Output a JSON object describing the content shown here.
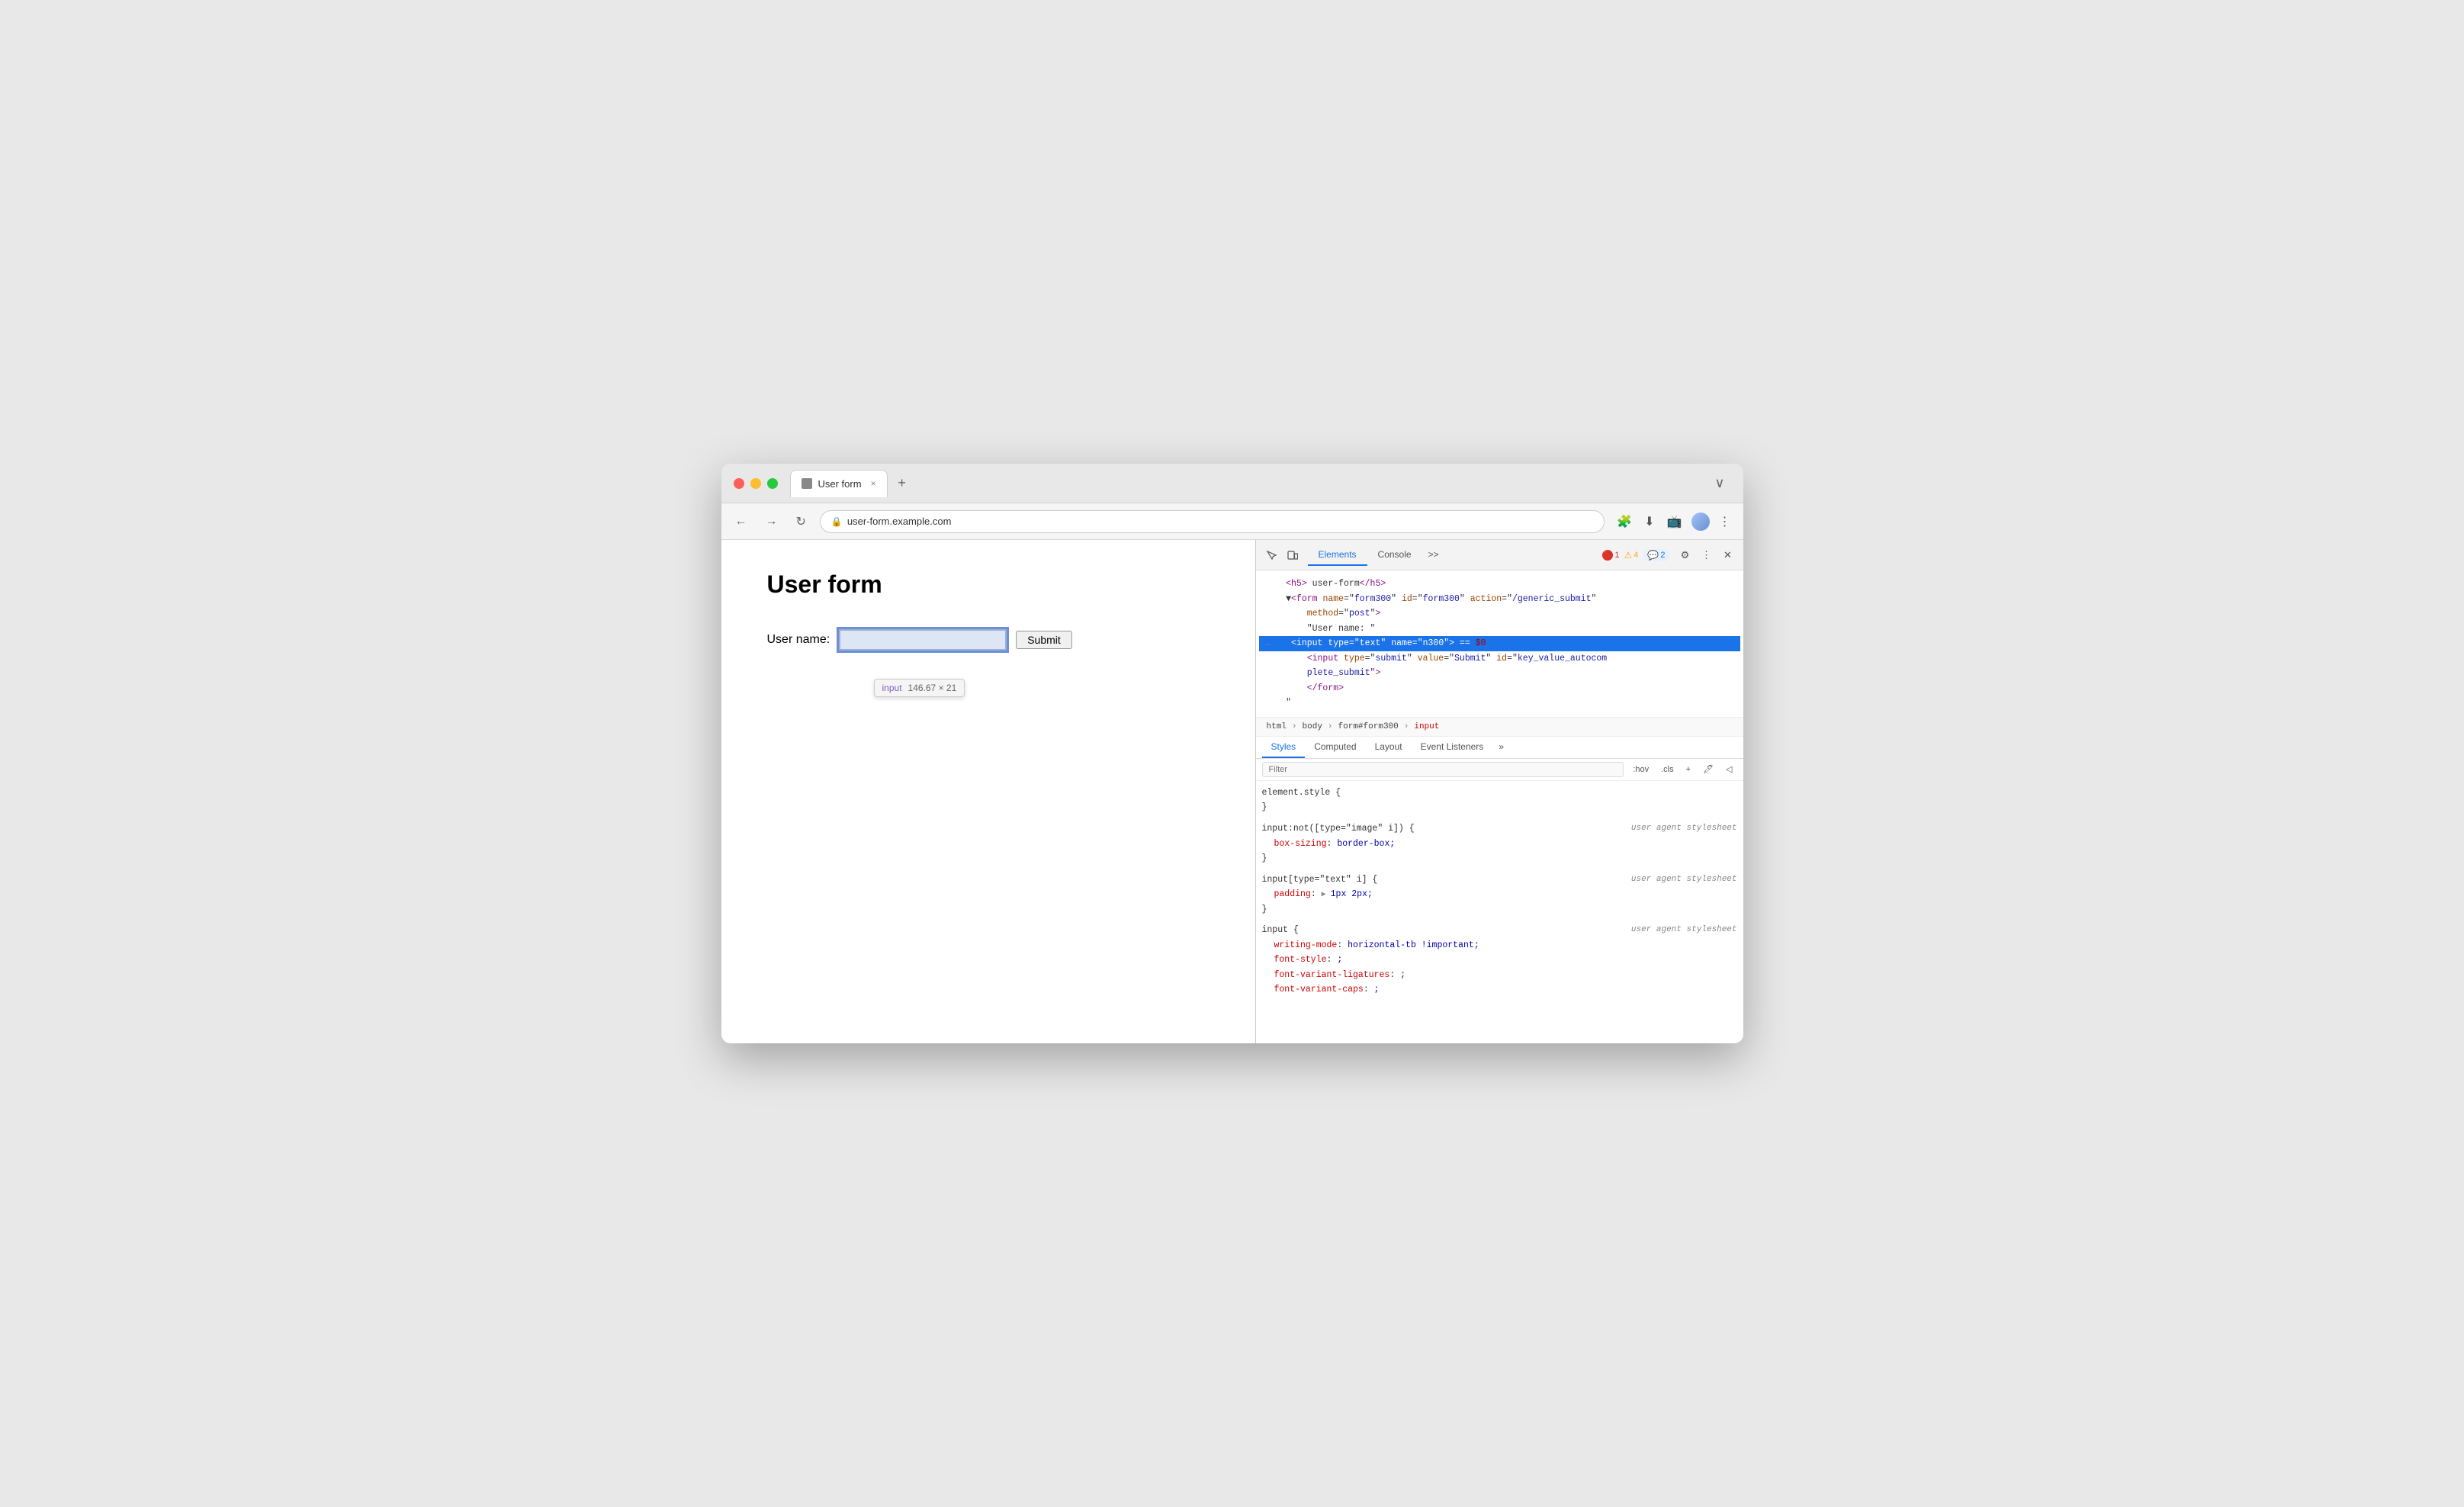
{
  "browser": {
    "tab": {
      "favicon": "page-icon",
      "title": "User form",
      "close": "×",
      "new_tab": "+"
    },
    "tab_more": "∨",
    "nav": {
      "back": "←",
      "forward": "→",
      "reload": "↻",
      "url": "user-form.example.com",
      "lock_icon": "🔒"
    },
    "toolbar": {
      "extensions": "🧩",
      "download": "⬇",
      "profile": "👤",
      "menu": "⋮",
      "cast": "📺"
    }
  },
  "page": {
    "title": "User form",
    "label": "User name:",
    "input_placeholder": "",
    "submit_label": "Submit",
    "tooltip": {
      "tag": "input",
      "size": "146.67 × 21"
    }
  },
  "devtools": {
    "header_icons": [
      "cursor-icon",
      "device-icon"
    ],
    "tabs": [
      "Elements",
      "Console"
    ],
    "tab_more": ">>",
    "status": {
      "errors": "1",
      "warnings": "4",
      "info": "2"
    },
    "settings_icon": "⚙",
    "more_icon": "⋮",
    "close_icon": "×",
    "elements_tree": [
      {
        "indent": 4,
        "content": "<h5>user-form</h5>",
        "html": "&lt;h5&gt; user-form &lt;/h5&gt;",
        "selected": false
      },
      {
        "indent": 4,
        "content": "form",
        "selected": false
      },
      {
        "indent": 6,
        "content": "\"User name: \"",
        "selected": false
      },
      {
        "indent": 6,
        "content": "input selected",
        "selected": true
      },
      {
        "indent": 6,
        "content": "input submit",
        "selected": false
      },
      {
        "indent": 4,
        "content": "/form",
        "selected": false
      },
      {
        "indent": 4,
        "content": "close",
        "selected": false
      }
    ],
    "breadcrumb": [
      "html",
      "body",
      "form#form300",
      "input"
    ],
    "styles_tabs": [
      "Styles",
      "Computed",
      "Layout",
      "Event Listeners"
    ],
    "styles_tab_more": "»",
    "filter_placeholder": "Filter",
    "filter_actions": [
      ":hov",
      ".cls",
      "+",
      "🖊",
      "◁▷"
    ],
    "css_rules": [
      {
        "selector": "element.style {",
        "close": "}",
        "properties": [],
        "source": ""
      },
      {
        "selector": "input:not([type=\"image\" i]) {",
        "close": "}",
        "properties": [
          {
            "name": "box-sizing",
            "value": "border-box;"
          }
        ],
        "source": "user agent stylesheet"
      },
      {
        "selector": "input[type=\"text\" i] {",
        "close": "}",
        "properties": [
          {
            "name": "padding",
            "value": "▶ 1px 2px;",
            "triangle": true
          }
        ],
        "source": "user agent stylesheet"
      },
      {
        "selector": "input {",
        "close": "",
        "properties": [
          {
            "name": "writing-mode",
            "value": "horizontal-tb !important;"
          },
          {
            "name": "font-style",
            "value": ";"
          },
          {
            "name": "font-variant-ligatures",
            "value": ";"
          },
          {
            "name": "font-variant-caps",
            "value": ";"
          }
        ],
        "source": "user agent stylesheet"
      }
    ]
  }
}
